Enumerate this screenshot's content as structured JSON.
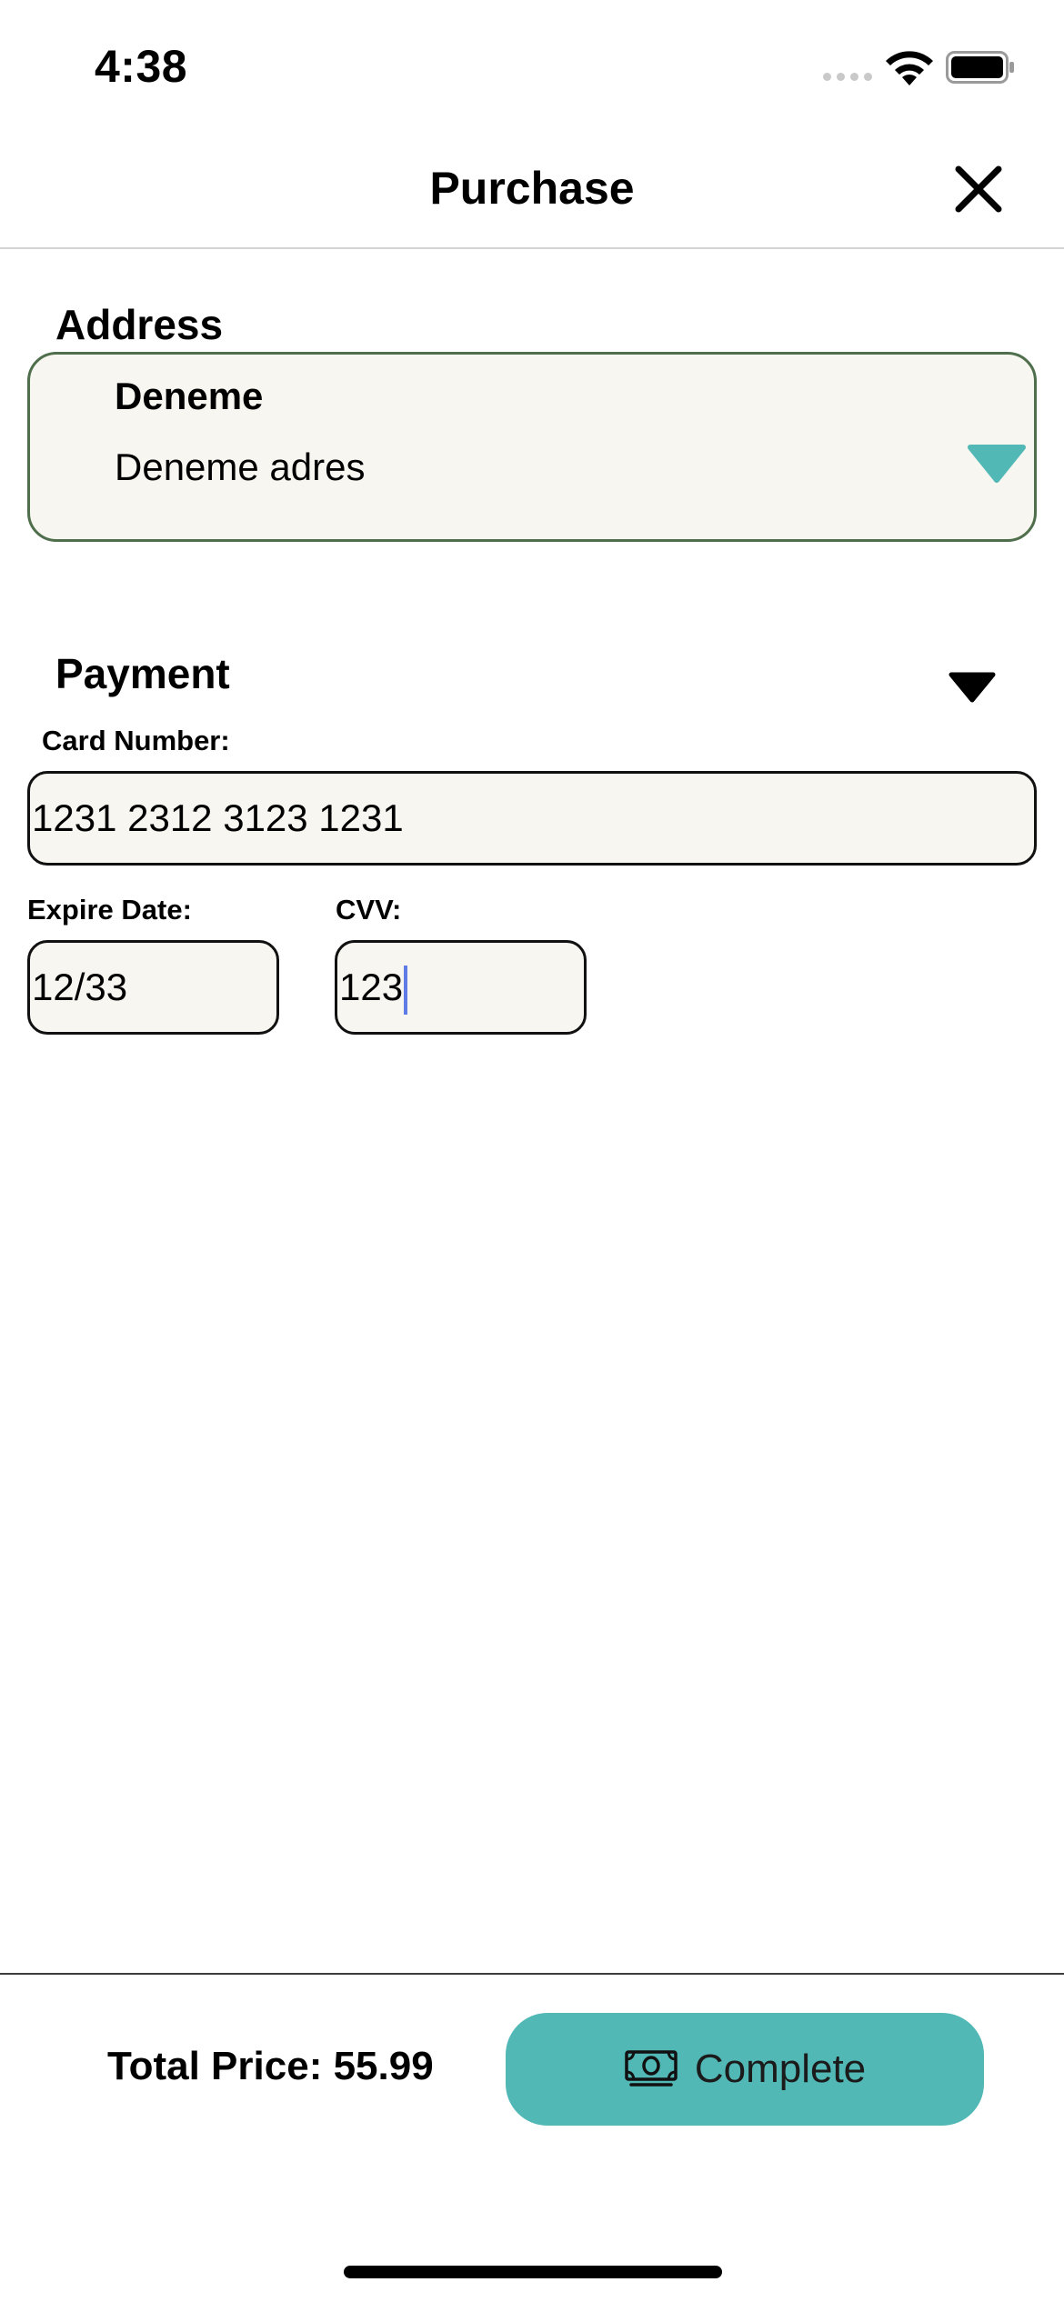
{
  "status_bar": {
    "time": "4:38"
  },
  "nav": {
    "title": "Purchase"
  },
  "address": {
    "section_title": "Address",
    "selected_name": "Deneme",
    "selected_line": "Deneme adres"
  },
  "payment": {
    "section_title": "Payment",
    "card_number_label": "Card Number:",
    "card_number_value": "1231 2312 3123 1231",
    "expire_label": "Expire Date:",
    "expire_value": "12/33",
    "cvv_label": "CVV:",
    "cvv_value": "123"
  },
  "footer": {
    "total_price": "Total Price: 55.99",
    "complete_label": "Complete"
  },
  "colors": {
    "accent": "#51b8b6",
    "address_border": "#4e6e4c",
    "field_bg": "#f8f6f0",
    "caret": "#5f7be6"
  },
  "icons": [
    "signal-dots-icon",
    "wifi-icon",
    "battery-icon",
    "close-icon",
    "dropdown-arrow-icon",
    "money-icon"
  ]
}
